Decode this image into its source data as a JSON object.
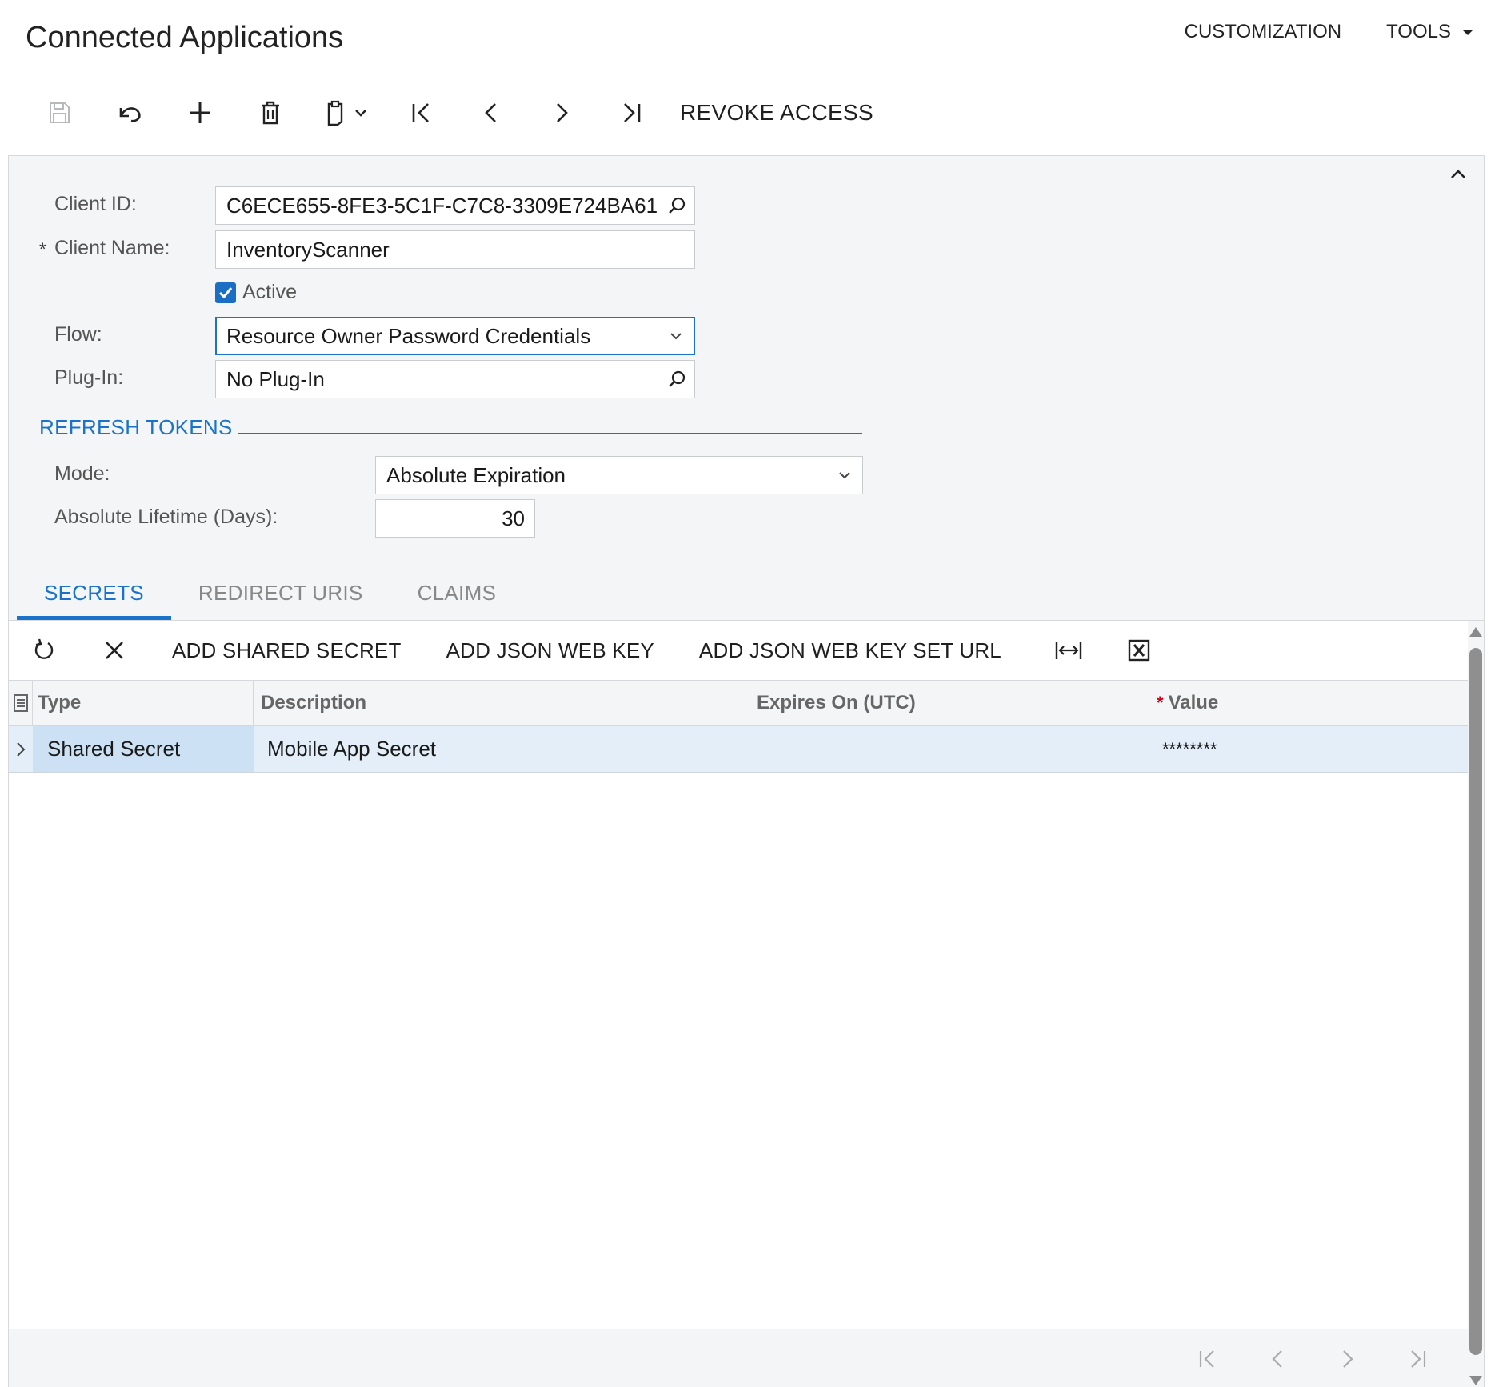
{
  "header": {
    "title": "Connected Applications",
    "menu": {
      "customization": "CUSTOMIZATION",
      "tools": "TOOLS"
    }
  },
  "toolbar": {
    "icons": [
      "save-icon",
      "undo-icon",
      "add-icon",
      "delete-icon",
      "clipboard-icon",
      "chevron-down-icon",
      "first-record-icon",
      "previous-record-icon",
      "next-record-icon",
      "last-record-icon"
    ],
    "revoke_label": "REVOKE ACCESS"
  },
  "form": {
    "client_id": {
      "label": "Client ID:",
      "value": "C6ECE655-8FE3-5C1F-C7C8-3309E724BA61"
    },
    "client_name": {
      "label": "Client Name:",
      "required_marker": "*",
      "value": "InventoryScanner"
    },
    "active": {
      "label": "Active",
      "checked": true
    },
    "flow": {
      "label": "Flow:",
      "value": "Resource Owner Password Credentials"
    },
    "plugin": {
      "label": "Plug-In:",
      "value": "No Plug-In"
    }
  },
  "refresh_tokens": {
    "title": "REFRESH TOKENS",
    "mode": {
      "label": "Mode:",
      "value": "Absolute Expiration"
    },
    "absolute_lifetime": {
      "label": "Absolute Lifetime (Days):",
      "value": "30"
    }
  },
  "tabs": [
    {
      "label": "SECRETS",
      "active": true
    },
    {
      "label": "REDIRECT URIS",
      "active": false
    },
    {
      "label": "CLAIMS",
      "active": false
    }
  ],
  "grid_toolbar": {
    "add_shared_secret": "ADD SHARED SECRET",
    "add_json_web_key": "ADD JSON WEB KEY",
    "add_json_web_key_set_url": "ADD JSON WEB KEY SET URL"
  },
  "grid": {
    "columns": [
      "Type",
      "Description",
      "Expires On (UTC)",
      "Value"
    ],
    "value_required_marker": "*",
    "rows": [
      {
        "type": "Shared Secret",
        "description": "Mobile App Secret",
        "expires_on": "",
        "value": "********"
      }
    ]
  },
  "colors": {
    "accent": "#1a73c9",
    "panel_bg": "#f4f5f7",
    "selected_row": "#e3eef9",
    "selected_cell": "#cce1f3",
    "required": "#d0021b"
  }
}
